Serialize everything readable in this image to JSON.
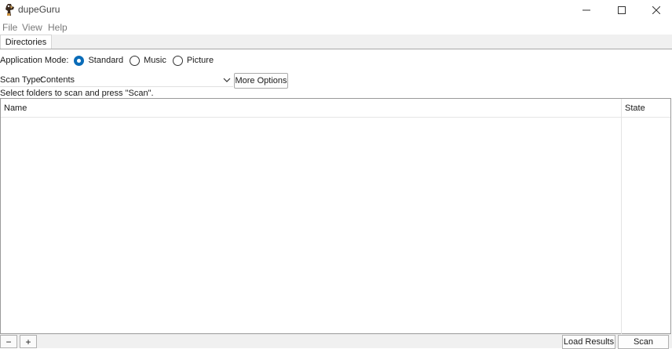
{
  "window": {
    "title": "dupeGuru",
    "icons": {
      "app": "dupeguru-app-icon",
      "minimize": "minimize-icon",
      "maximize": "maximize-icon",
      "close": "close-icon"
    }
  },
  "menu": [
    "File",
    "View",
    "Help"
  ],
  "tabs": [
    {
      "label": "Directories",
      "active": true
    }
  ],
  "mode": {
    "label": "Application Mode:",
    "options": [
      {
        "label": "Standard",
        "selected": true
      },
      {
        "label": "Music",
        "selected": false
      },
      {
        "label": "Picture",
        "selected": false
      }
    ],
    "accent": "#0a6cb8"
  },
  "scan": {
    "label": "Scan Type:",
    "value": "Contents",
    "more_options": "More Options"
  },
  "hint": "Select folders to scan and press \"Scan\".",
  "table": {
    "columns": [
      "Name",
      "State"
    ],
    "rows": []
  },
  "bottom": {
    "remove_label": "−",
    "add_label": "+",
    "load_results": "Load Results",
    "scan": "Scan"
  }
}
